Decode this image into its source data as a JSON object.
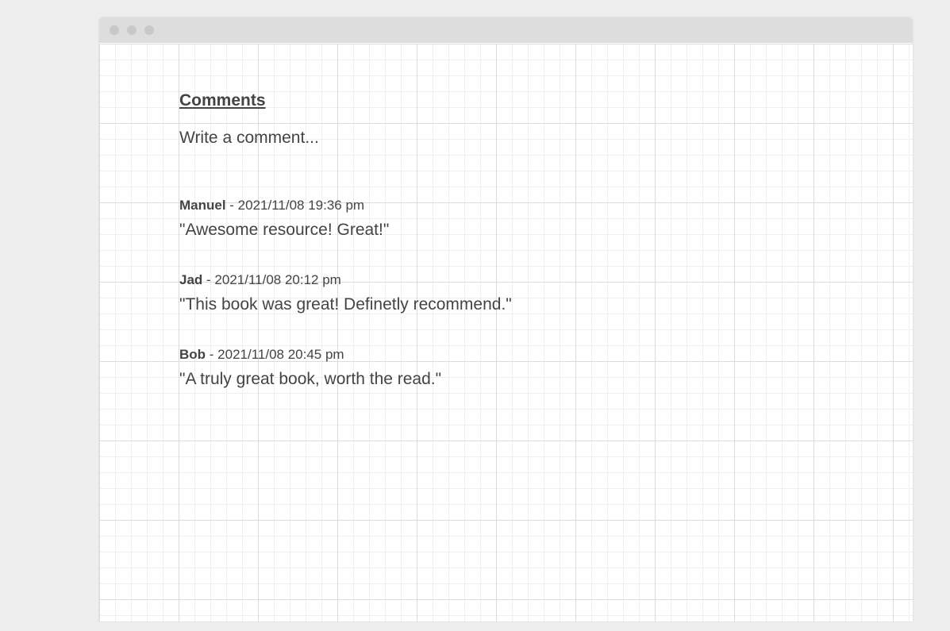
{
  "comments_section": {
    "title": "Comments",
    "input": {
      "placeholder": "Write a comment...",
      "value": ""
    },
    "separator": " - ",
    "comments": [
      {
        "author": "Manuel",
        "timestamp": "2021/11/08 19:36 pm",
        "text": "\"Awesome resource! Great!\""
      },
      {
        "author": "Jad",
        "timestamp": "2021/11/08 20:12 pm",
        "text": "\"This book was great! Definetly recommend.\""
      },
      {
        "author": "Bob",
        "timestamp": "2021/11/08 20:45 pm",
        "text": "\"A truly great book, worth the read.\""
      }
    ]
  },
  "colors": {
    "text": "#444444",
    "page_background": "#eeeeee",
    "titlebar": "#dddddd",
    "window_dot": "#c8c8c8"
  }
}
